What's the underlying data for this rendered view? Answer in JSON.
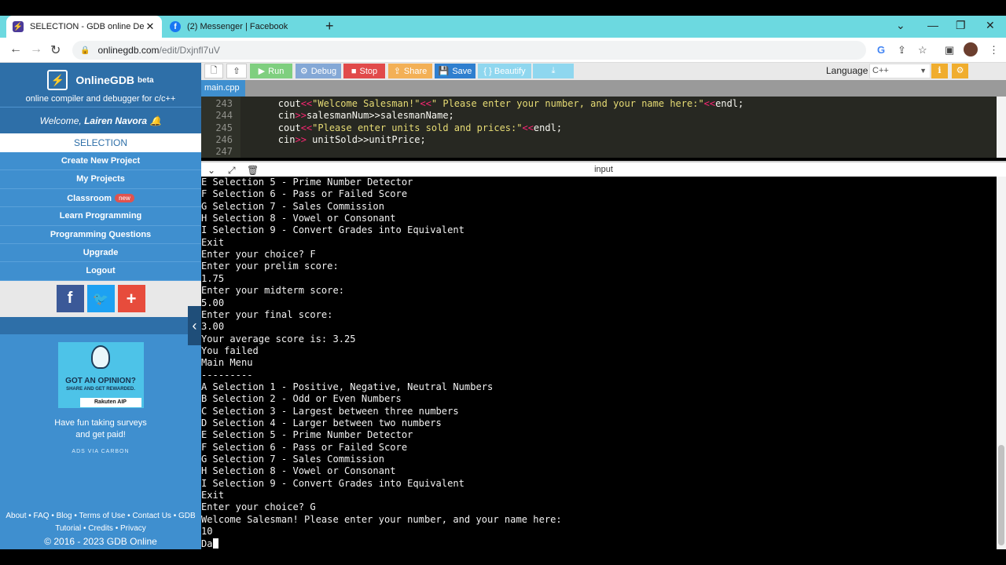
{
  "browser": {
    "tabs": [
      {
        "title": "SELECTION - GDB online Debugger",
        "active": true
      },
      {
        "title": "(2) Messenger | Facebook",
        "active": false
      }
    ],
    "url_host": "onlinegdb.com",
    "url_path": "/edit/Dxjnfl7uV"
  },
  "sidebar": {
    "brand": "OnlineGDB",
    "beta": "beta",
    "tagline": "online compiler and debugger for c/c++",
    "welcome_prefix": "Welcome, ",
    "user_name": "Lairen Navora",
    "current": "SELECTION",
    "menu": [
      {
        "label": "Create New Project"
      },
      {
        "label": "My Projects"
      },
      {
        "label": "Classroom",
        "badge": "new"
      },
      {
        "label": "Learn Programming"
      },
      {
        "label": "Programming Questions"
      },
      {
        "label": "Upgrade"
      },
      {
        "label": "Logout"
      }
    ],
    "ad": {
      "headline": "GOT AN OPINION?",
      "sub": "SHARE AND GET REWARDED.",
      "brand": "Rakuten AIP",
      "text_line1": "Have fun taking surveys",
      "text_line2": "and get paid!",
      "via": "ADS VIA CARBON"
    },
    "footer_links1": "About • FAQ • Blog • Terms of Use • Contact Us • GDB",
    "footer_links2": "Tutorial • Credits • Privacy",
    "copyright": "© 2016 - 2023 GDB Online"
  },
  "toolbar": {
    "run": "Run",
    "debug": "Debug",
    "stop": "Stop",
    "share": "Share",
    "save": "Save",
    "beautify": "{ } Beautify",
    "language_label": "Language",
    "language": "C++"
  },
  "file_tab": "main.cpp",
  "io_label": "input",
  "editor": {
    "lines": [
      {
        "n": "243",
        "pre": "        ",
        "k1": "cout",
        "o1": "<<",
        "s1": "\"Welcome Salesman!\"",
        "o2": "<<",
        "s2": "\" Please enter your number, and your name here:\"",
        "o3": "<<",
        "t": "endl;"
      },
      {
        "n": "244",
        "pre": "        ",
        "k1": "cin",
        "o1": ">>",
        "s1": "",
        "o2": "",
        "s2": "",
        "o3": "",
        "t": "salesmanNum>>salesmanName;"
      },
      {
        "n": "245",
        "pre": "        ",
        "k1": "cout",
        "o1": "<<",
        "s1": "\"Please enter units sold and prices:\"",
        "o2": "<<",
        "s2": "",
        "o3": "",
        "t": "endl;"
      },
      {
        "n": "246",
        "pre": "        ",
        "k1": "cin",
        "o1": ">> ",
        "s1": "",
        "o2": "",
        "s2": "",
        "o3": "",
        "t": "unitSold>>unitPrice;"
      },
      {
        "n": "247",
        "pre": "",
        "k1": "",
        "o1": "",
        "s1": "",
        "o2": "",
        "s2": "",
        "o3": "",
        "t": ""
      }
    ]
  },
  "console": [
    "E Selection 5 - Prime Number Detector",
    "F Selection 6 - Pass or Failed Score",
    "G Selection 7 - Sales Commission",
    "H Selection 8 - Vowel or Consonant",
    "I Selection 9 - Convert Grades into Equivalent",
    "Exit",
    "Enter your choice? F",
    "Enter your prelim score:",
    "1.75",
    "Enter your midterm score:",
    "5.00",
    "Enter your final score:",
    "3.00",
    "Your average score is: 3.25",
    "You failed",
    "Main Menu",
    "---------",
    "A Selection 1 - Positive, Negative, Neutral Numbers",
    "B Selection 2 - Odd or Even Numbers",
    "C Selection 3 - Largest between three numbers",
    "D Selection 4 - Larger between two numbers",
    "E Selection 5 - Prime Number Detector",
    "F Selection 6 - Pass or Failed Score",
    "G Selection 7 - Sales Commission",
    "H Selection 8 - Vowel or Consonant",
    "I Selection 9 - Convert Grades into Equivalent",
    "Exit",
    "Enter your choice? G",
    "Welcome Salesman! Please enter your number, and your name here:",
    "10",
    "Da"
  ],
  "colors": {
    "sidebar": "#3f8fcf",
    "sidebar_dark": "#2e6fa8",
    "tabstrip": "#6cd9e0",
    "run": "#7fcf7f",
    "stop": "#e14a4a",
    "save": "#2f7fcf"
  }
}
